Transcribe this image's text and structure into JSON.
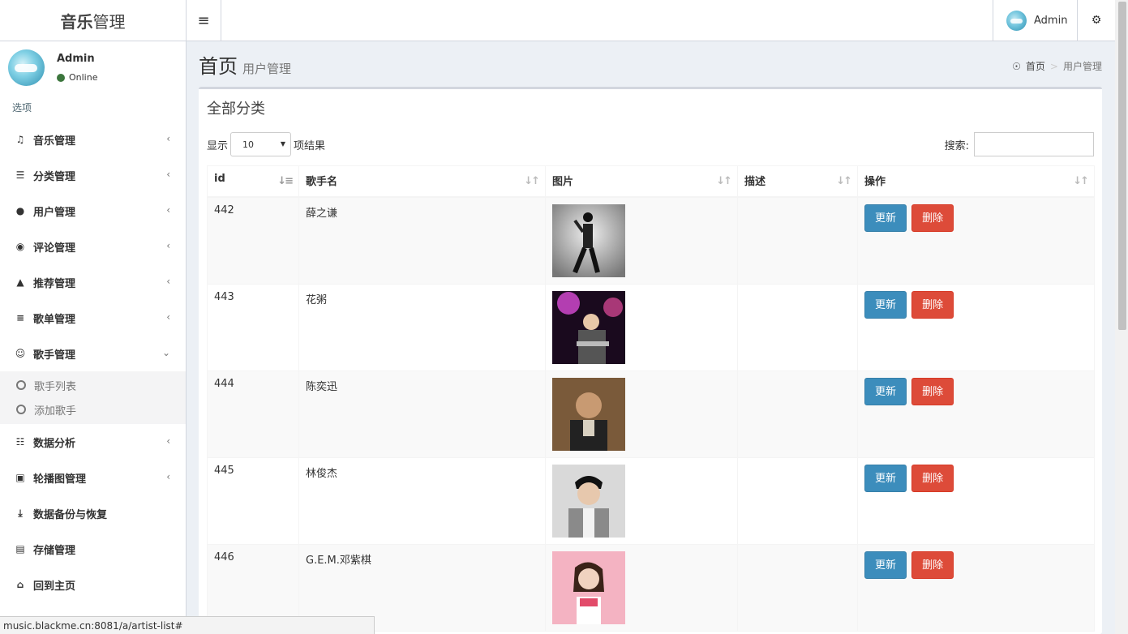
{
  "logo": {
    "bold": "音乐",
    "light": "管理"
  },
  "topbar": {
    "user_name": "Admin"
  },
  "sidebar": {
    "user": {
      "name": "Admin",
      "status": "Online"
    },
    "header": "选项",
    "items": [
      {
        "label": "音乐管理",
        "icon": "music-icon"
      },
      {
        "label": "分类管理",
        "icon": "list-icon"
      },
      {
        "label": "用户管理",
        "icon": "user-icon"
      },
      {
        "label": "评论管理",
        "icon": "comment-icon"
      },
      {
        "label": "推荐管理",
        "icon": "sitemap-icon"
      },
      {
        "label": "歌单管理",
        "icon": "sliders-icon"
      },
      {
        "label": "歌手管理",
        "icon": "user-circle-icon"
      },
      {
        "label": "数据分析",
        "icon": "database-icon"
      },
      {
        "label": "轮播图管理",
        "icon": "image-icon"
      },
      {
        "label": "数据备份与恢复",
        "icon": "download-icon"
      },
      {
        "label": "存储管理",
        "icon": "storage-icon"
      },
      {
        "label": "回到主页",
        "icon": "home-icon"
      }
    ],
    "subitems": [
      {
        "label": "歌手列表"
      },
      {
        "label": "添加歌手"
      }
    ]
  },
  "page": {
    "title": "首页",
    "subtitle": "用户管理"
  },
  "breadcrumb": {
    "home": "首页",
    "current": "用户管理"
  },
  "box": {
    "title": "全部分类",
    "length_prefix": "显示",
    "length_value": "10",
    "length_suffix": "项结果",
    "search_label": "搜索:"
  },
  "table": {
    "columns": [
      "id",
      "歌手名",
      "图片",
      "描述",
      "操作"
    ],
    "rows": [
      {
        "id": "442",
        "name": "薛之谦",
        "desc": ""
      },
      {
        "id": "443",
        "name": "花粥",
        "desc": ""
      },
      {
        "id": "444",
        "name": "陈奕迅",
        "desc": ""
      },
      {
        "id": "445",
        "name": "林俊杰",
        "desc": ""
      },
      {
        "id": "446",
        "name": "G.E.M.邓紫棋",
        "desc": ""
      }
    ],
    "update_label": "更新",
    "delete_label": "删除"
  },
  "statusbar": {
    "url": "music.blackme.cn:8081/a/artist-list#"
  },
  "colors": {
    "primary": "#3c8dbc",
    "danger": "#dd4b39",
    "online": "#3c763d"
  }
}
